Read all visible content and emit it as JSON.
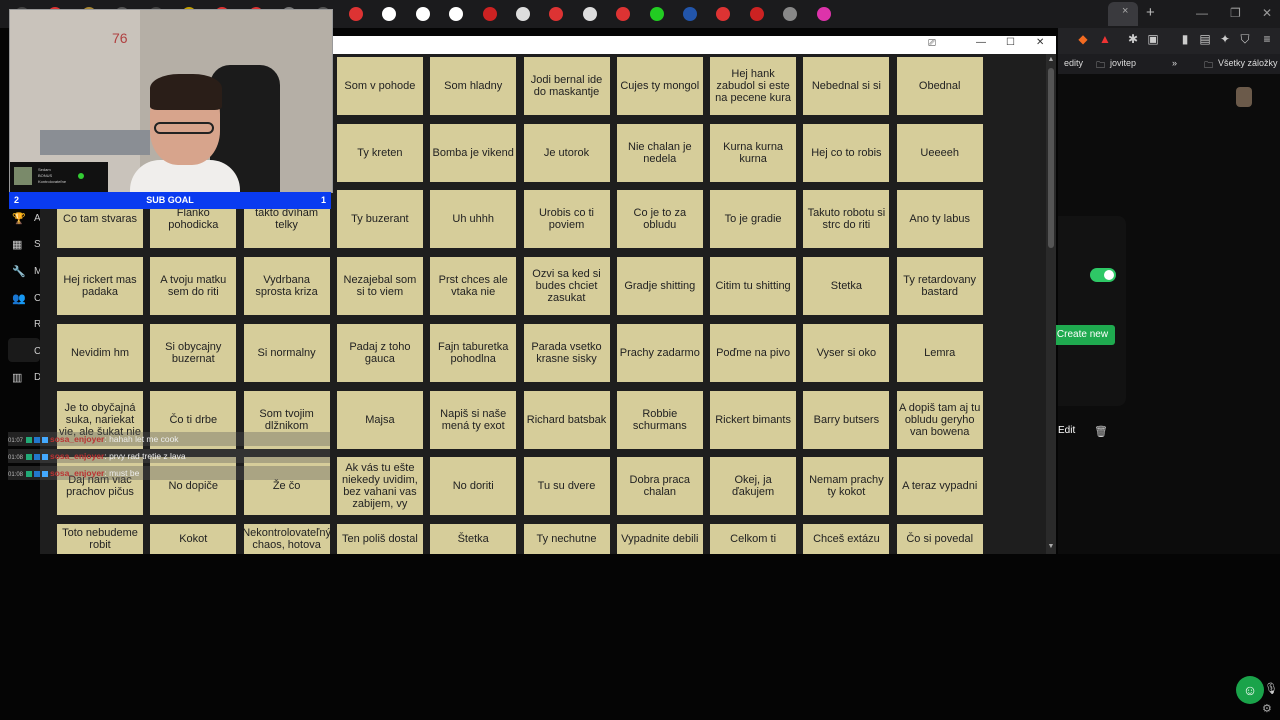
{
  "browser": {
    "tab_close": "×",
    "new_tab": "+",
    "window_controls": [
      "—",
      "❐",
      "✕"
    ],
    "toolbar_icons": [
      "brave-shield-icon",
      "extensions-icon",
      "sidebar-icon",
      "wallet-icon",
      "vpn-icon",
      "menu-icon"
    ],
    "bookmarks": [
      {
        "label": "edity"
      },
      {
        "label": "jovitep"
      },
      {
        "label": "»"
      },
      {
        "label": "Všetky záložky"
      }
    ]
  },
  "bingo_window": {
    "controls": [
      "⎚",
      "—",
      "☐",
      "✕"
    ],
    "scroll_up": "▲",
    "scroll_down": "▼",
    "cells": [
      "Som v pohode",
      "Som hladny",
      "Jodi bernal ide do maskantje",
      "Cujes ty mongol",
      "Hej hank zabudol si este na pecene kura",
      "Nebednal si si",
      "Obednal",
      "Ty kreten",
      "Bomba je vikend",
      "Je utorok",
      "Nie chalan je nedela",
      "Kurna kurna kurna",
      "Hej co to robis",
      "Ueeeeh",
      "Co tam stvaras",
      "Flanko pohodicka",
      "takto dvíham telky",
      "Ty buzerant",
      "Uh uhhh",
      "Urobis co ti poviem",
      "Co je to za obludu",
      "To je gradie",
      "Takuto robotu si strc do riti",
      "Ano ty labus",
      "Hej rickert mas padaka",
      "A tvoju matku sem do riti",
      "Vydrbana sprosta kriza",
      "Nezajebal som si to viem",
      "Prst chces ale vtaka nie",
      "Ozvi sa ked si budes chciet zasukat",
      "Gradje shitting",
      "Citim tu shitting",
      "Stetka",
      "Ty retardovany bastard",
      "Nevidim hm",
      "Si obycajny buzernat",
      "Si normalny",
      "Padaj z toho gauca",
      "Fajn taburetka pohodlna",
      "Parada vsetko krasne sisky",
      "Prachy zadarmo",
      "Poďme na pivo",
      "Vyser si oko",
      "Lemra",
      "Je to obyčajná suka, nariekat vie, ale šukat nie",
      "Čo ti drbe",
      "Som tvojim dlžnikom",
      "Majsa",
      "Napiš si naše mená ty exot",
      "Richard batsbak",
      "Robbie schurmans",
      "Rickert bimants",
      "Barry butsers",
      "A dopiš tam aj tu obludu geryho van bowena",
      "Daj nam viac prachov pičus",
      "No dopiče",
      "Že čo",
      "Ak vás tu ešte niekedy uvidim, bez vahani vas zabijem, vy",
      "No doriti",
      "Tu su dvere",
      "Dobra praca chalan",
      "Okej, ja ďakujem",
      "Nemam prachy ty kokot",
      "A teraz vypadni",
      "Toto nebudeme robit",
      "Kokot",
      "Nekontrolovateľný chaos, hotova",
      "Ten poliš dostal",
      "Štetka",
      "Ty nechutne",
      "Vypadnite debili",
      "Celkom ti",
      "Chceš extázu",
      "Čo si povedal"
    ]
  },
  "stream": {
    "cam_number": "76",
    "widget_lines": [
      "Sedam",
      "BONUS",
      "Kontrolovateľne"
    ],
    "subgoal": {
      "left": "2",
      "title": "SUB GOAL",
      "right": "1"
    },
    "chat": [
      {
        "time": "01:07",
        "user": "sosa_enjoyer",
        "message": ": hahah let me cook"
      },
      {
        "time": "01:08",
        "user": "sosa_enjoyer",
        "message": ": prvy rad tretie z lava"
      },
      {
        "time": "01:08",
        "user": "sosa_enjoyer",
        "message": ": must be"
      }
    ]
  },
  "background_app": {
    "sidebar_labels": [
      "A",
      "S",
      "M",
      "C",
      "R",
      "C",
      "D"
    ],
    "create_new": "Create new",
    "edit": "Edit"
  }
}
